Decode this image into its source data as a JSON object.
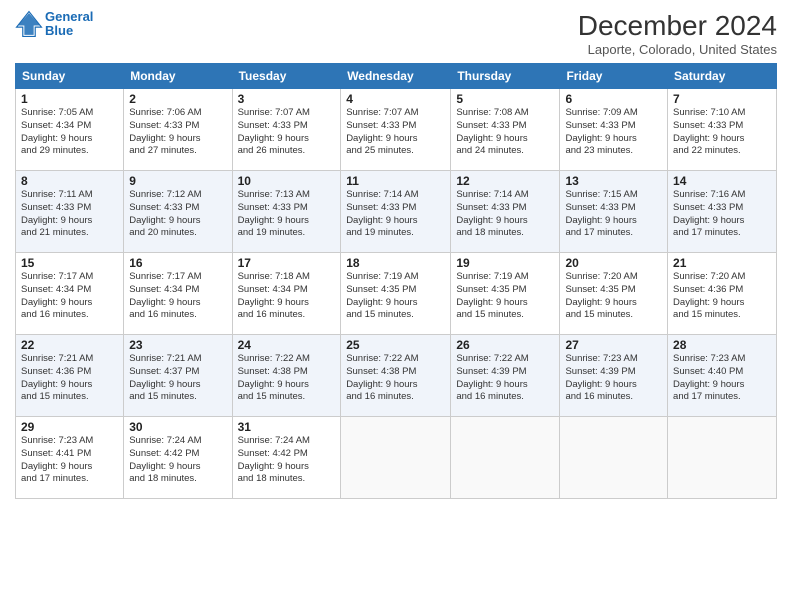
{
  "header": {
    "logo_line1": "General",
    "logo_line2": "Blue",
    "title": "December 2024",
    "location": "Laporte, Colorado, United States"
  },
  "days_of_week": [
    "Sunday",
    "Monday",
    "Tuesday",
    "Wednesday",
    "Thursday",
    "Friday",
    "Saturday"
  ],
  "weeks": [
    [
      {
        "day": "1",
        "info": "Sunrise: 7:05 AM\nSunset: 4:34 PM\nDaylight: 9 hours\nand 29 minutes."
      },
      {
        "day": "2",
        "info": "Sunrise: 7:06 AM\nSunset: 4:33 PM\nDaylight: 9 hours\nand 27 minutes."
      },
      {
        "day": "3",
        "info": "Sunrise: 7:07 AM\nSunset: 4:33 PM\nDaylight: 9 hours\nand 26 minutes."
      },
      {
        "day": "4",
        "info": "Sunrise: 7:07 AM\nSunset: 4:33 PM\nDaylight: 9 hours\nand 25 minutes."
      },
      {
        "day": "5",
        "info": "Sunrise: 7:08 AM\nSunset: 4:33 PM\nDaylight: 9 hours\nand 24 minutes."
      },
      {
        "day": "6",
        "info": "Sunrise: 7:09 AM\nSunset: 4:33 PM\nDaylight: 9 hours\nand 23 minutes."
      },
      {
        "day": "7",
        "info": "Sunrise: 7:10 AM\nSunset: 4:33 PM\nDaylight: 9 hours\nand 22 minutes."
      }
    ],
    [
      {
        "day": "8",
        "info": "Sunrise: 7:11 AM\nSunset: 4:33 PM\nDaylight: 9 hours\nand 21 minutes."
      },
      {
        "day": "9",
        "info": "Sunrise: 7:12 AM\nSunset: 4:33 PM\nDaylight: 9 hours\nand 20 minutes."
      },
      {
        "day": "10",
        "info": "Sunrise: 7:13 AM\nSunset: 4:33 PM\nDaylight: 9 hours\nand 19 minutes."
      },
      {
        "day": "11",
        "info": "Sunrise: 7:14 AM\nSunset: 4:33 PM\nDaylight: 9 hours\nand 19 minutes."
      },
      {
        "day": "12",
        "info": "Sunrise: 7:14 AM\nSunset: 4:33 PM\nDaylight: 9 hours\nand 18 minutes."
      },
      {
        "day": "13",
        "info": "Sunrise: 7:15 AM\nSunset: 4:33 PM\nDaylight: 9 hours\nand 17 minutes."
      },
      {
        "day": "14",
        "info": "Sunrise: 7:16 AM\nSunset: 4:33 PM\nDaylight: 9 hours\nand 17 minutes."
      }
    ],
    [
      {
        "day": "15",
        "info": "Sunrise: 7:17 AM\nSunset: 4:34 PM\nDaylight: 9 hours\nand 16 minutes."
      },
      {
        "day": "16",
        "info": "Sunrise: 7:17 AM\nSunset: 4:34 PM\nDaylight: 9 hours\nand 16 minutes."
      },
      {
        "day": "17",
        "info": "Sunrise: 7:18 AM\nSunset: 4:34 PM\nDaylight: 9 hours\nand 16 minutes."
      },
      {
        "day": "18",
        "info": "Sunrise: 7:19 AM\nSunset: 4:35 PM\nDaylight: 9 hours\nand 15 minutes."
      },
      {
        "day": "19",
        "info": "Sunrise: 7:19 AM\nSunset: 4:35 PM\nDaylight: 9 hours\nand 15 minutes."
      },
      {
        "day": "20",
        "info": "Sunrise: 7:20 AM\nSunset: 4:35 PM\nDaylight: 9 hours\nand 15 minutes."
      },
      {
        "day": "21",
        "info": "Sunrise: 7:20 AM\nSunset: 4:36 PM\nDaylight: 9 hours\nand 15 minutes."
      }
    ],
    [
      {
        "day": "22",
        "info": "Sunrise: 7:21 AM\nSunset: 4:36 PM\nDaylight: 9 hours\nand 15 minutes."
      },
      {
        "day": "23",
        "info": "Sunrise: 7:21 AM\nSunset: 4:37 PM\nDaylight: 9 hours\nand 15 minutes."
      },
      {
        "day": "24",
        "info": "Sunrise: 7:22 AM\nSunset: 4:38 PM\nDaylight: 9 hours\nand 15 minutes."
      },
      {
        "day": "25",
        "info": "Sunrise: 7:22 AM\nSunset: 4:38 PM\nDaylight: 9 hours\nand 16 minutes."
      },
      {
        "day": "26",
        "info": "Sunrise: 7:22 AM\nSunset: 4:39 PM\nDaylight: 9 hours\nand 16 minutes."
      },
      {
        "day": "27",
        "info": "Sunrise: 7:23 AM\nSunset: 4:39 PM\nDaylight: 9 hours\nand 16 minutes."
      },
      {
        "day": "28",
        "info": "Sunrise: 7:23 AM\nSunset: 4:40 PM\nDaylight: 9 hours\nand 17 minutes."
      }
    ],
    [
      {
        "day": "29",
        "info": "Sunrise: 7:23 AM\nSunset: 4:41 PM\nDaylight: 9 hours\nand 17 minutes."
      },
      {
        "day": "30",
        "info": "Sunrise: 7:24 AM\nSunset: 4:42 PM\nDaylight: 9 hours\nand 18 minutes."
      },
      {
        "day": "31",
        "info": "Sunrise: 7:24 AM\nSunset: 4:42 PM\nDaylight: 9 hours\nand 18 minutes."
      },
      null,
      null,
      null,
      null
    ]
  ]
}
